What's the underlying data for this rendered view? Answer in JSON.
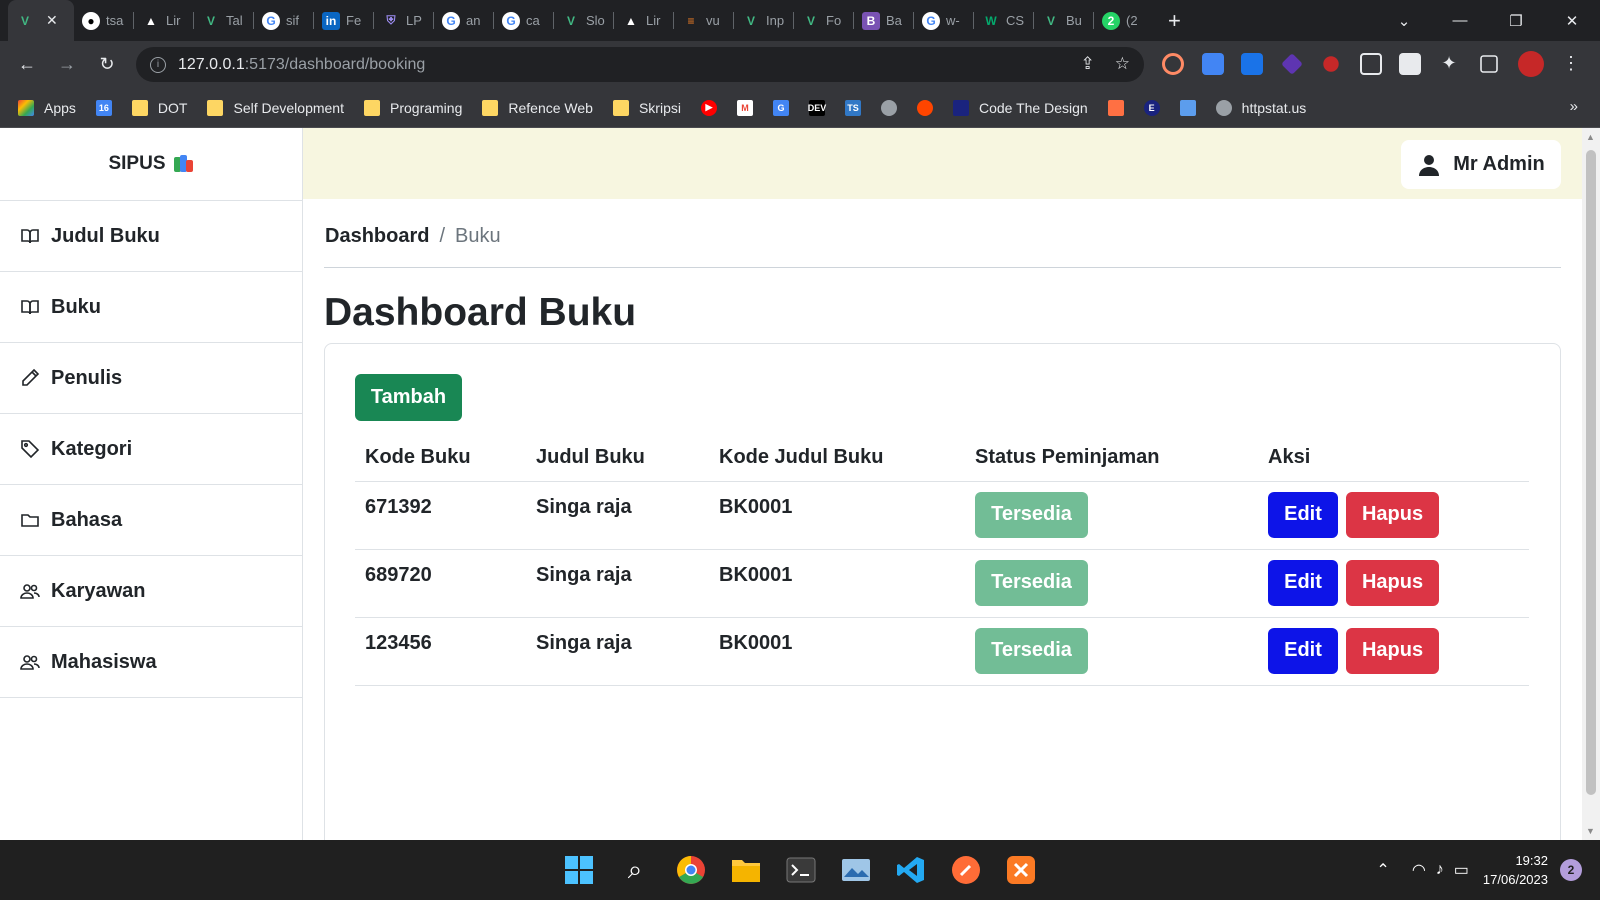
{
  "browser": {
    "tabs": [
      {
        "icon": "vue-icon",
        "title": "",
        "active": true
      },
      {
        "icon": "github-icon",
        "title": "tsa"
      },
      {
        "icon": "vercel-icon",
        "title": "Lir"
      },
      {
        "icon": "vite-icon",
        "title": "Tal"
      },
      {
        "icon": "google-icon",
        "title": "sif"
      },
      {
        "icon": "linkedin-icon",
        "title": "Fe"
      },
      {
        "icon": "shield-icon",
        "title": "LP"
      },
      {
        "icon": "google-icon",
        "title": "an"
      },
      {
        "icon": "google-icon",
        "title": "ca"
      },
      {
        "icon": "vue-icon",
        "title": "Slo"
      },
      {
        "icon": "vercel-icon",
        "title": "Lir"
      },
      {
        "icon": "stackoverflow-icon",
        "title": "vu"
      },
      {
        "icon": "vite-icon",
        "title": "Inp"
      },
      {
        "icon": "vite-icon",
        "title": "Fo"
      },
      {
        "icon": "bootstrap-icon",
        "title": "Ba"
      },
      {
        "icon": "google-icon",
        "title": "w-"
      },
      {
        "icon": "w3schools-icon",
        "title": "CS"
      },
      {
        "icon": "vite-icon",
        "title": "Bu"
      },
      {
        "icon": "whatsapp-icon",
        "title": "(2"
      }
    ],
    "url_host": "127.0.0.1",
    "url_path": ":5173/dashboard/booking",
    "bookmarks": [
      {
        "label": "Apps",
        "icon": "apps-icon"
      },
      {
        "label": "",
        "icon": "calendar-icon"
      },
      {
        "label": "DOT",
        "icon": "folder-icon"
      },
      {
        "label": "Self Development",
        "icon": "folder-icon"
      },
      {
        "label": "Programing",
        "icon": "folder-icon"
      },
      {
        "label": "Refence Web",
        "icon": "folder-icon"
      },
      {
        "label": "Skripsi",
        "icon": "folder-icon"
      },
      {
        "label": "",
        "icon": "youtube-icon"
      },
      {
        "label": "",
        "icon": "gmail-icon"
      },
      {
        "label": "",
        "icon": "translate-icon"
      },
      {
        "label": "",
        "icon": "dev-icon"
      },
      {
        "label": "",
        "icon": "typescript-icon"
      },
      {
        "label": "",
        "icon": "globe-icon"
      },
      {
        "label": "",
        "icon": "reddit-icon"
      },
      {
        "label": "Code The Design",
        "icon": "codethedesign-icon"
      },
      {
        "label": "",
        "icon": "grid-icon"
      },
      {
        "label": "",
        "icon": "e-icon"
      },
      {
        "label": "",
        "icon": "bicycle-icon"
      },
      {
        "label": "httpstat.us",
        "icon": "globe-icon"
      }
    ]
  },
  "sidebar": {
    "brand": "SIPUS",
    "items": [
      {
        "label": "Judul Buku",
        "icon": "book-icon"
      },
      {
        "label": "Buku",
        "icon": "book-icon"
      },
      {
        "label": "Penulis",
        "icon": "pencil-icon"
      },
      {
        "label": "Kategori",
        "icon": "tag-icon"
      },
      {
        "label": "Bahasa",
        "icon": "folder-icon"
      },
      {
        "label": "Karyawan",
        "icon": "people-icon"
      },
      {
        "label": "Mahasiswa",
        "icon": "people-icon"
      }
    ]
  },
  "topbar": {
    "user": "Mr Admin"
  },
  "breadcrumb": {
    "root": "Dashboard",
    "sep": "/",
    "current": "Buku"
  },
  "page": {
    "title": "Dashboard Buku",
    "add_label": "Tambah"
  },
  "table": {
    "headers": [
      "Kode Buku",
      "Judul Buku",
      "Kode Judul Buku",
      "Status Peminjaman",
      "Aksi"
    ],
    "rows": [
      {
        "kode": "671392",
        "judul": "Singa raja",
        "kode_judul": "BK0001",
        "status": "Tersedia"
      },
      {
        "kode": "689720",
        "judul": "Singa raja",
        "kode_judul": "BK0001",
        "status": "Tersedia"
      },
      {
        "kode": "123456",
        "judul": "Singa raja",
        "kode_judul": "BK0001",
        "status": "Tersedia"
      }
    ],
    "edit_label": "Edit",
    "delete_label": "Hapus"
  },
  "taskbar": {
    "time": "19:32",
    "date": "17/06/2023",
    "notifications": "2"
  },
  "colors": {
    "success": "#198754",
    "badge": "#72bd96",
    "edit": "#0d14e8",
    "danger": "#dc3545",
    "topbar": "#f7f6e0"
  }
}
